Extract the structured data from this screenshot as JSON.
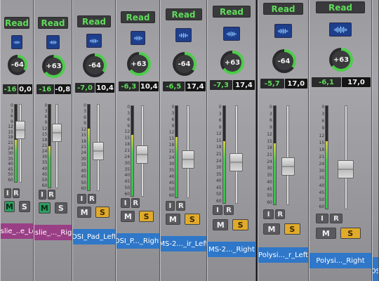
{
  "colors": {
    "pink_name": "#9a3f86",
    "blue_name": "#2f77c8",
    "mute_green": "#2f9d62",
    "solo_orange": "#e0aa2a",
    "btn_gray": "#5a5a5e"
  },
  "scale_ticks": [
    "0",
    "3",
    "6",
    "9",
    "12",
    "15",
    "18",
    "21",
    "24",
    "30",
    "35",
    "40",
    "45",
    "50",
    "60"
  ],
  "strips": [
    {
      "read": "Read",
      "knob": "-64",
      "left": "-16",
      "right": "0,0",
      "input": "I",
      "record": "R",
      "mute": "M",
      "solo": "S",
      "mute_active": true,
      "solo_active": false,
      "name": "Leslie_..e_Left",
      "name_color": "pink",
      "knob_level": 0.35,
      "meter_level": 0.55,
      "fader_level": 0.72
    },
    {
      "read": "Read",
      "knob": "+63",
      "left": "-16",
      "right": "-0,8",
      "input": "I",
      "record": "R",
      "mute": "M",
      "solo": "S",
      "mute_active": true,
      "solo_active": false,
      "name": "Leslie_..._Right",
      "name_color": "pink",
      "knob_level": 0.65,
      "meter_level": 0.5,
      "fader_level": 0.7
    },
    {
      "read": "Read",
      "knob": "-64",
      "left": "-7,0",
      "right": "10,4",
      "input": "I",
      "record": "R",
      "mute": "M",
      "solo": "S",
      "mute_active": false,
      "solo_active": true,
      "name": "DSI_Pad_Left",
      "name_color": "blue",
      "knob_level": 0.35,
      "meter_level": 0.72,
      "fader_level": 0.45
    },
    {
      "read": "Read",
      "knob": "+63",
      "left": "-6,3",
      "right": "10,4",
      "input": "I",
      "record": "R",
      "mute": "M",
      "solo": "S",
      "mute_active": false,
      "solo_active": true,
      "name": "DSI_P..._Right",
      "name_color": "blue",
      "knob_level": 0.65,
      "meter_level": 0.68,
      "fader_level": 0.45
    },
    {
      "read": "Read",
      "knob": "-64",
      "left": "-6,5",
      "right": "17,4",
      "input": "I",
      "record": "R",
      "mute": "M",
      "solo": "S",
      "mute_active": false,
      "solo_active": true,
      "name": "MS-2..._ir_Left",
      "name_color": "blue",
      "knob_level": 0.35,
      "meter_level": 0.66,
      "fader_level": 0.4
    },
    {
      "read": "Read",
      "knob": "+63",
      "left": "-7,3",
      "right": "17,4",
      "input": "I",
      "record": "R",
      "mute": "M",
      "solo": "S",
      "mute_active": false,
      "solo_active": true,
      "name": "MS-2..._Right",
      "name_color": "blue",
      "knob_level": 0.65,
      "meter_level": 0.64,
      "fader_level": 0.4
    },
    {
      "read": "Read",
      "knob": "-64",
      "left": "-5,7",
      "right": "17,0",
      "input": "I",
      "record": "R",
      "mute": "M",
      "solo": "S",
      "mute_active": false,
      "solo_active": true,
      "name": "Polysi..._r_Left",
      "name_color": "blue",
      "knob_level": 0.35,
      "meter_level": 0.62,
      "fader_level": 0.36
    },
    {
      "read": "Read",
      "knob": "+63",
      "left": "-6,1",
      "right": "17,0",
      "input": "I",
      "record": "R",
      "mute": "M",
      "solo": "S",
      "mute_active": false,
      "solo_active": true,
      "name": "Polysi..._Right",
      "name_color": "blue",
      "knob_level": 0.65,
      "meter_level": 0.66,
      "fader_level": 0.36
    },
    {
      "read": "",
      "knob": "",
      "left": "",
      "right": "",
      "input": "",
      "record": "",
      "mute": "",
      "solo": "",
      "mute_active": false,
      "solo_active": false,
      "name": "DS",
      "name_color": "blue",
      "knob_level": 0,
      "meter_level": 0,
      "fader_level": 0
    }
  ]
}
